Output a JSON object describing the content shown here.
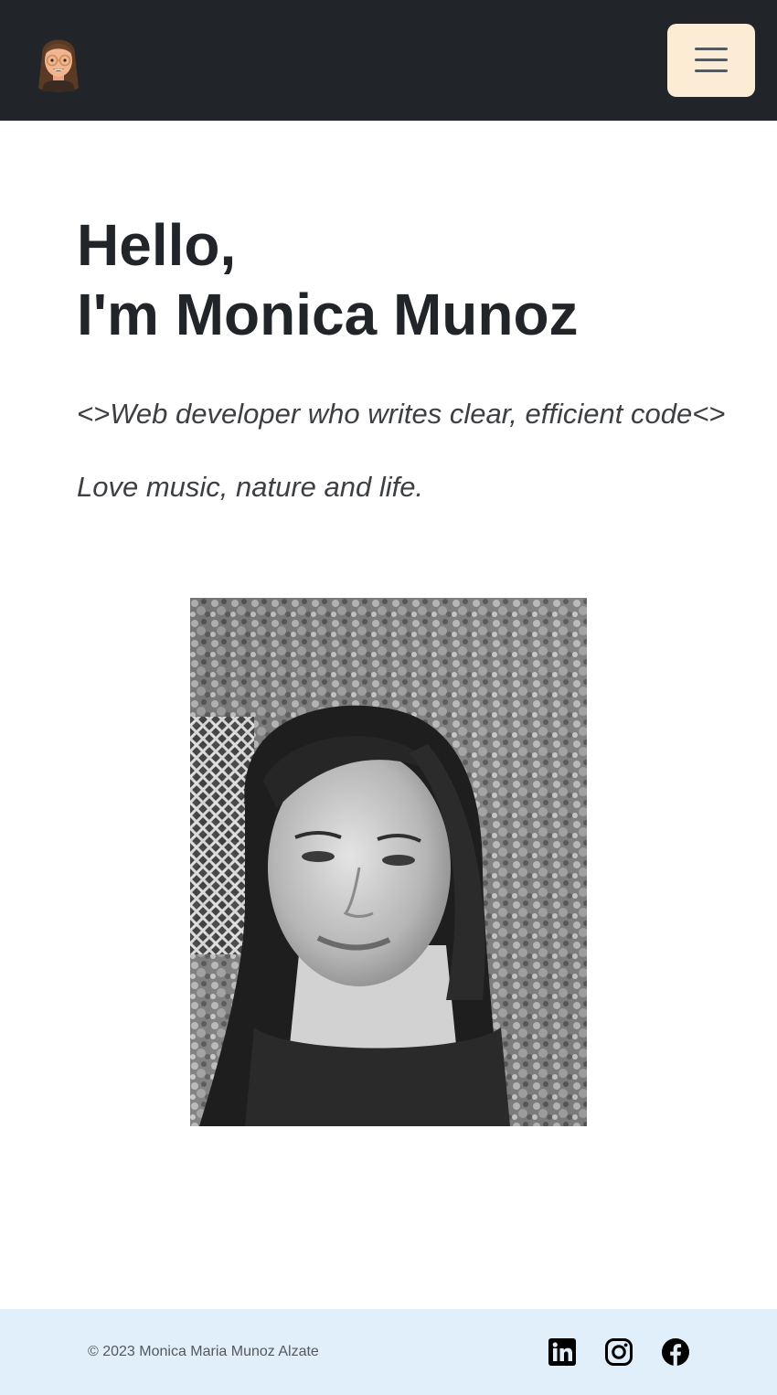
{
  "navbar": {
    "logo_icon": "memoji-avatar-icon",
    "menu_icon": "hamburger-menu-icon",
    "colors": {
      "background": "#212529",
      "menu_button": "#fcebd5"
    }
  },
  "hero": {
    "greeting": "Hello,",
    "name_line": "I'm Monica Munoz",
    "tagline": "<>Web developer who writes clear, efficient code<>",
    "subtagline": "Love music, nature and life.",
    "photo_icon": "portrait-photo"
  },
  "footer": {
    "copyright": "© 2023 Monica Maria Munoz Alzate",
    "social": [
      {
        "icon": "linkedin-icon"
      },
      {
        "icon": "instagram-icon"
      },
      {
        "icon": "facebook-icon"
      }
    ],
    "colors": {
      "background": "#e1effa"
    }
  }
}
